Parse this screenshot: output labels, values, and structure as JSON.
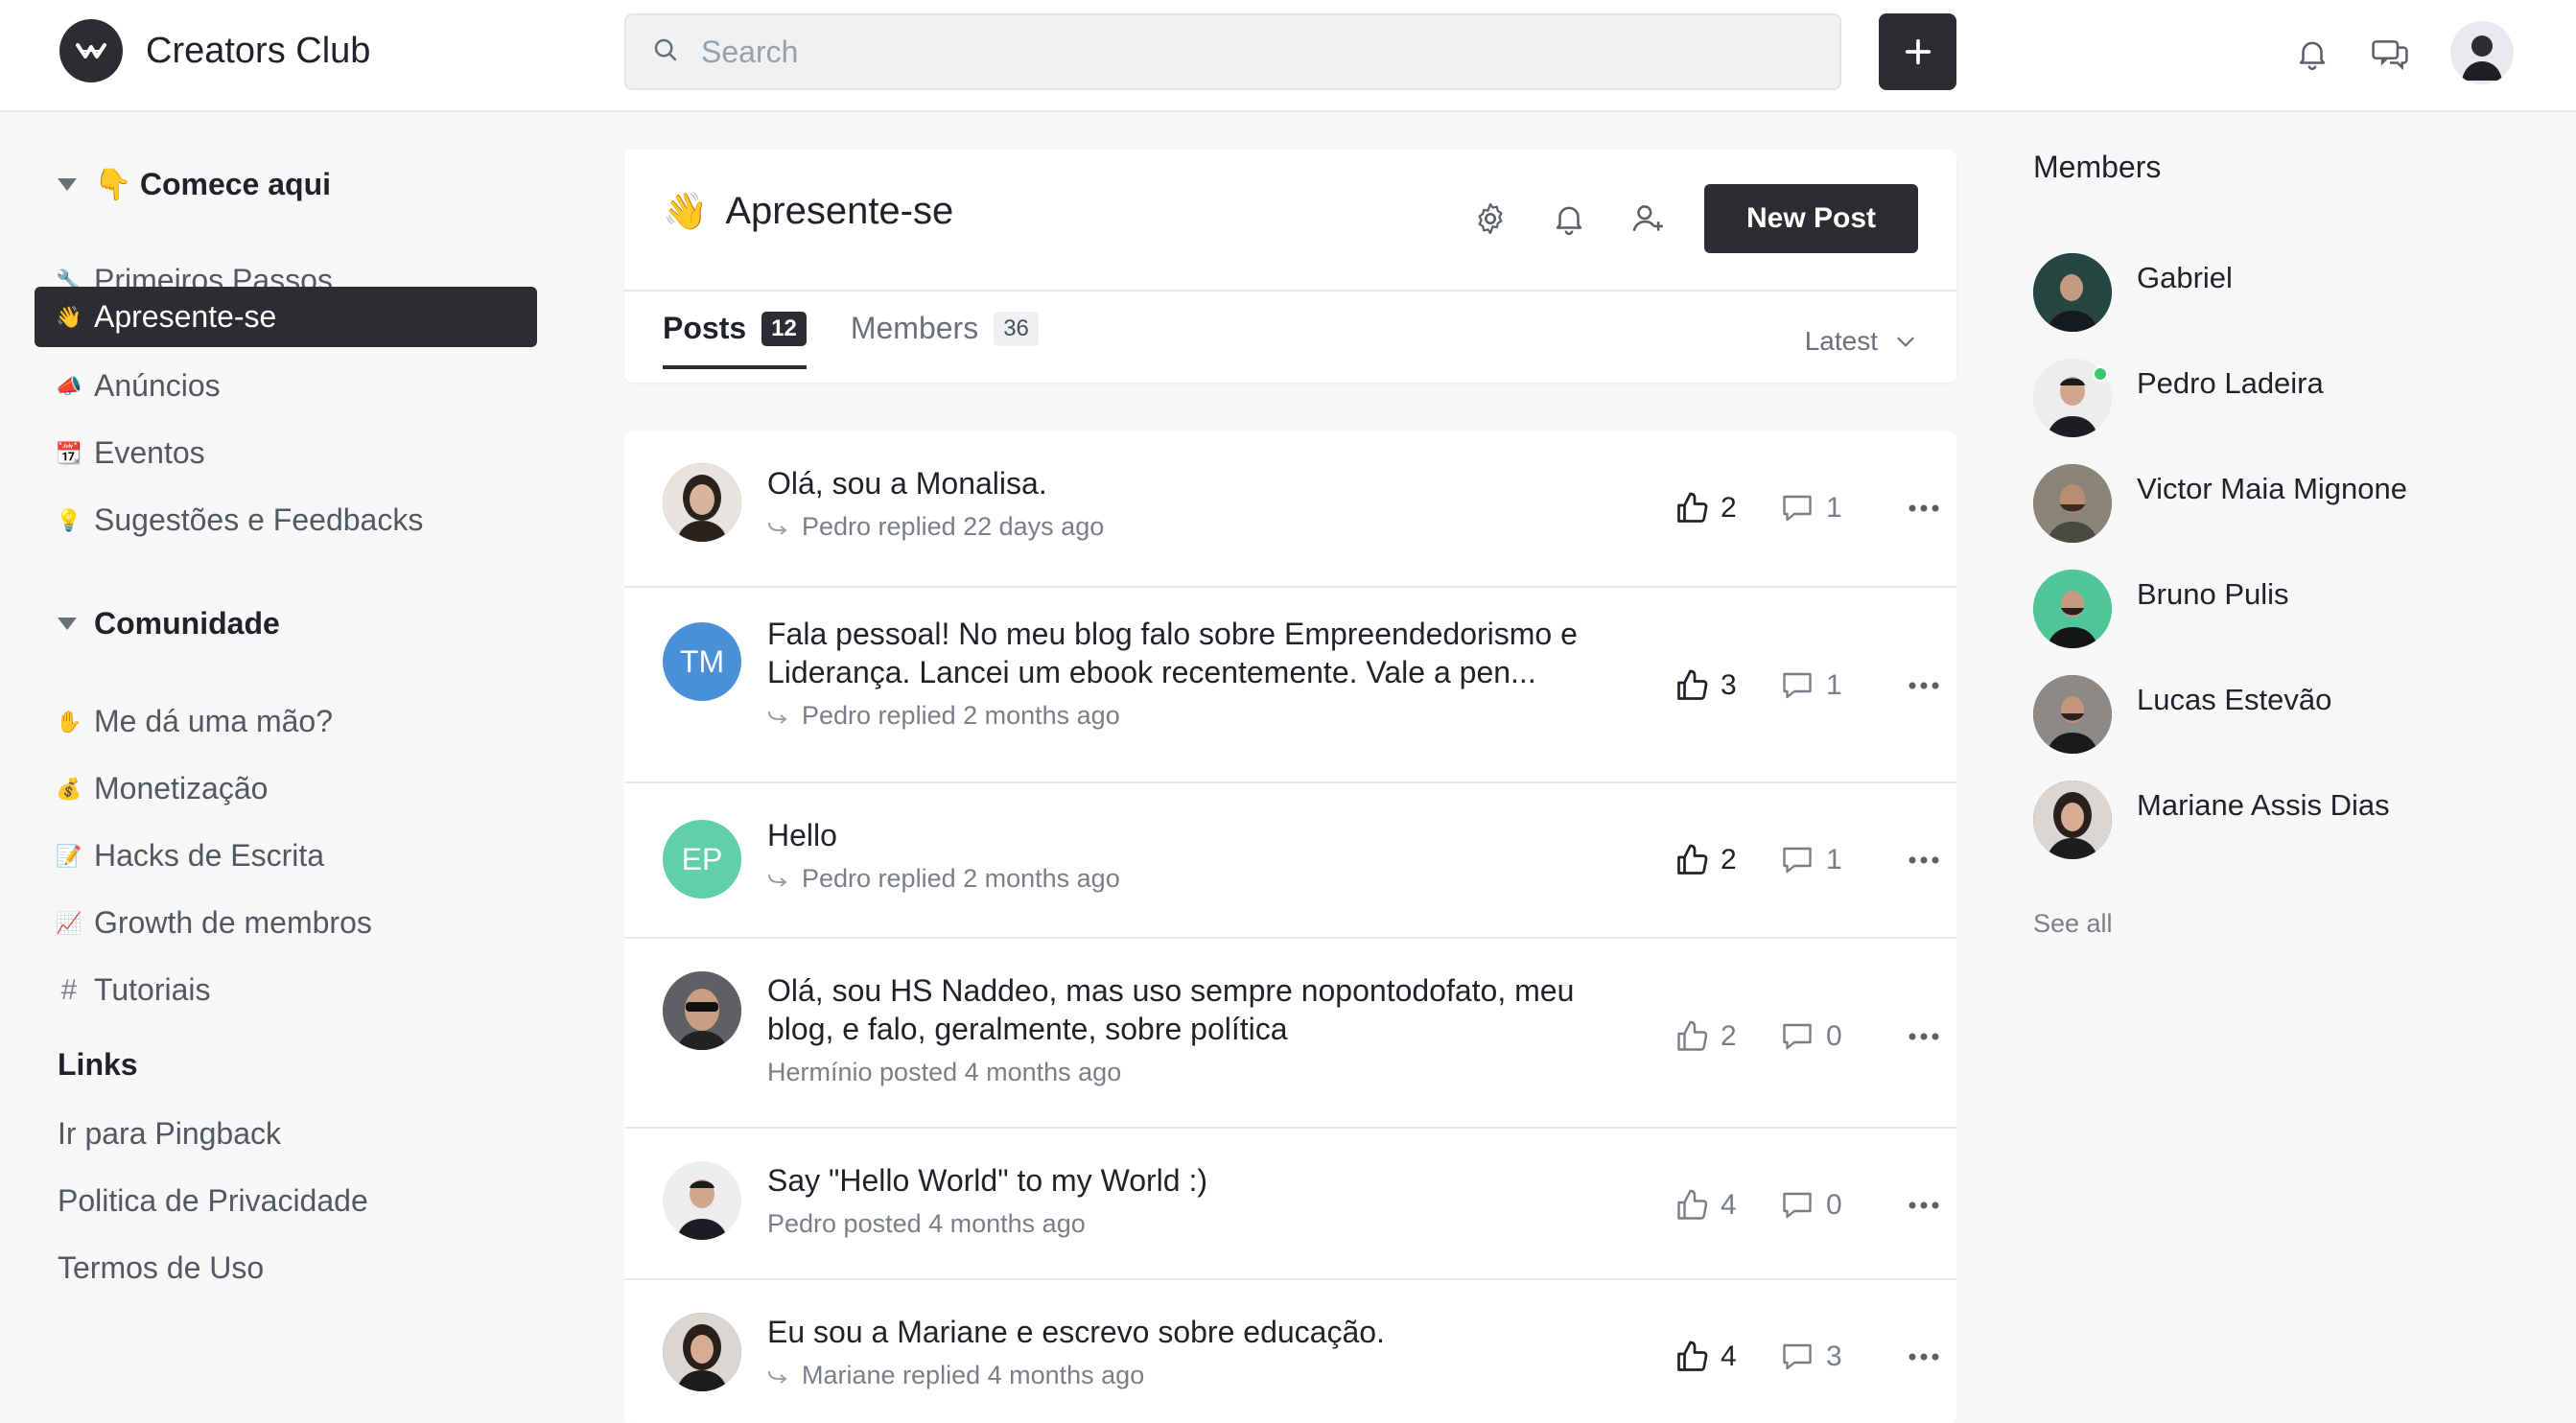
{
  "brand": {
    "title": "Creators Club"
  },
  "search": {
    "placeholder": "Search"
  },
  "sidebar": {
    "sections": [
      {
        "title": "Comece aqui",
        "emoji": "👇",
        "items": [
          {
            "label": "Primeiros Passos",
            "emoji": "🔧"
          },
          {
            "label": "Apresente-se",
            "emoji": "👋",
            "active": true
          },
          {
            "label": "Anúncios",
            "emoji": "📣"
          },
          {
            "label": "Eventos",
            "emoji": "📆"
          },
          {
            "label": "Sugestões e Feedbacks",
            "emoji": "💡"
          }
        ]
      },
      {
        "title": "Comunidade",
        "items": [
          {
            "label": "Me dá uma mão?",
            "emoji": "✋"
          },
          {
            "label": "Monetização",
            "emoji": "💰"
          },
          {
            "label": "Hacks de Escrita",
            "emoji": "📝"
          },
          {
            "label": "Growth de membros",
            "emoji": "📈"
          },
          {
            "label": "Tutoriais",
            "emoji": "#"
          }
        ]
      }
    ],
    "links": {
      "title": "Links",
      "items": [
        "Ir para Pingback",
        "Politica de Privacidade",
        "Termos de Uso"
      ]
    }
  },
  "space": {
    "emoji": "👋",
    "title": "Apresente-se",
    "new_post_label": "New Post",
    "tabs": [
      {
        "label": "Posts",
        "count": "12"
      },
      {
        "label": "Members",
        "count": "36"
      }
    ],
    "sort_label": "Latest"
  },
  "posts": [
    {
      "title": "Olá, sou a Monalisa.",
      "meta": "Pedro replied 22 days ago",
      "reply": true,
      "likes": "2",
      "comments": "1",
      "liked": true,
      "avatar": {
        "type": "photo",
        "color": "#5a4f47"
      }
    },
    {
      "title": "Fala pessoal! No meu blog falo sobre Empreendedorismo e Liderança. Lancei um ebook recentemente. Vale a pen...",
      "meta": "Pedro replied 2 months ago",
      "reply": true,
      "likes": "3",
      "comments": "1",
      "liked": true,
      "avatar": {
        "type": "initials",
        "text": "TM",
        "color": "#4a90d9"
      }
    },
    {
      "title": "Hello",
      "meta": "Pedro replied 2 months ago",
      "reply": true,
      "likes": "2",
      "comments": "1",
      "liked": true,
      "avatar": {
        "type": "initials",
        "text": "EP",
        "color": "#5fd0a8"
      }
    },
    {
      "title": "Olá, sou HS Naddeo, mas uso sempre nopontodofato, meu blog, e falo, geralmente, sobre política",
      "meta": "Hermínio posted 4 months ago",
      "reply": false,
      "likes": "2",
      "comments": "0",
      "liked": false,
      "avatar": {
        "type": "photo",
        "color": "#3d3f42"
      }
    },
    {
      "title": "Say \"Hello World\" to my World :)",
      "meta": "Pedro posted 4 months ago",
      "reply": false,
      "likes": "4",
      "comments": "0",
      "liked": false,
      "avatar": {
        "type": "photo",
        "color": "#e6e6e8"
      }
    },
    {
      "title": "Eu sou a Mariane e escrevo sobre educação.",
      "meta": "Mariane replied 4 months ago",
      "reply": true,
      "likes": "4",
      "comments": "3",
      "liked": true,
      "avatar": {
        "type": "photo",
        "color": "#4b3a34"
      }
    }
  ],
  "members_panel": {
    "title": "Members",
    "members": [
      {
        "name": "Gabriel",
        "color": "#2d4f4a",
        "online": false
      },
      {
        "name": "Pedro Ladeira",
        "color": "#e8e8ea",
        "online": true
      },
      {
        "name": "Victor Maia Mignone",
        "color": "#6b6a5e",
        "online": false
      },
      {
        "name": "Bruno Pulis",
        "color": "#4fc59a",
        "online": false
      },
      {
        "name": "Lucas Estevão",
        "color": "#5a5554",
        "online": false
      },
      {
        "name": "Mariane Assis Dias",
        "color": "#4b3a34",
        "online": false
      }
    ],
    "see_all": "See all"
  },
  "colors": {
    "accent": "#2b2d31",
    "online": "#3cc66b"
  }
}
